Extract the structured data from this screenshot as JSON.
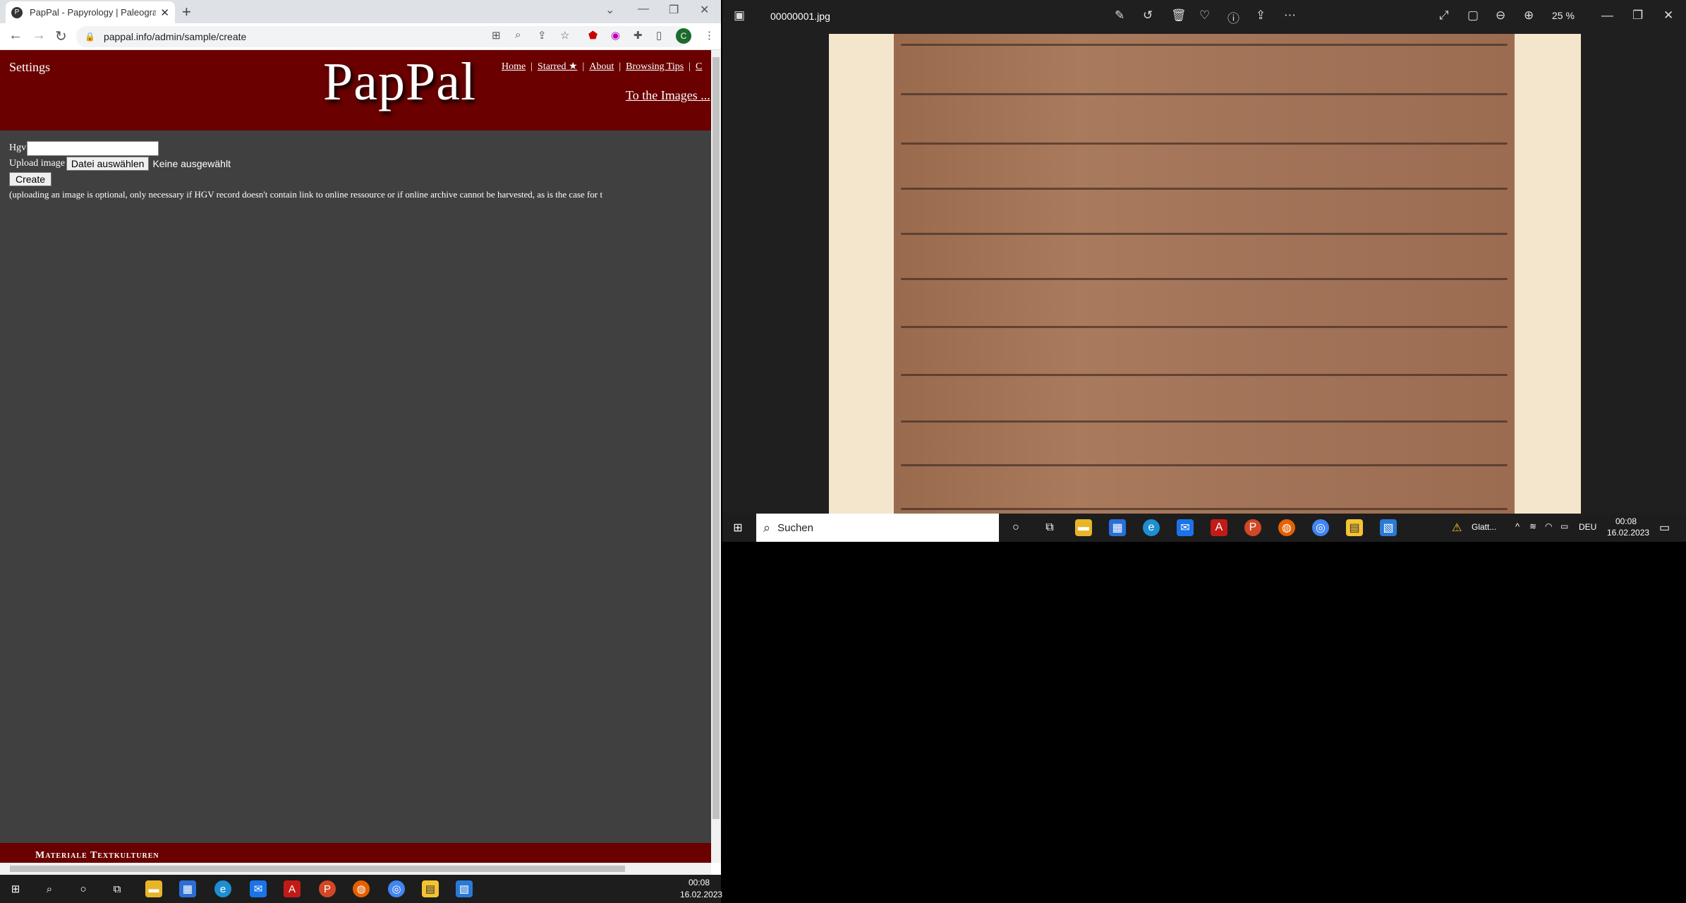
{
  "browser": {
    "tab_title": "PapPal - Papyrology | Paleograph",
    "tab_favicon": "P",
    "url": "pappal.info/admin/sample/create",
    "profile_initial": "C"
  },
  "site": {
    "settings": "Settings",
    "logo": "PapPal",
    "nav": [
      {
        "label": "Home"
      },
      {
        "label": "Starred ★"
      },
      {
        "label": "About"
      },
      {
        "label": "Browsing Tips"
      },
      {
        "label": "C"
      }
    ],
    "to_images": "To the Images ...",
    "form": {
      "hgv_label": "Hgv",
      "upload_label": "Upload image",
      "choose_file": "Datei auswählen",
      "no_file": "Keine ausgewählt",
      "create": "Create",
      "note": "(uploading an image is optional, only necessary if HGV record doesn't contain link to online ressource or if online archive cannot be harvested, as is the case for t"
    },
    "footer": "Materiale Textkulturen"
  },
  "photos": {
    "file_name": "00000001.jpg",
    "zoom": "25 %"
  },
  "taskbar_right": {
    "search": "Suchen",
    "alert": "Glatt...",
    "lang": "DEU",
    "time": "00:08",
    "date": "16.02.2023"
  },
  "taskbar_left": {
    "time": "00:08",
    "date": "16.02.2023"
  }
}
